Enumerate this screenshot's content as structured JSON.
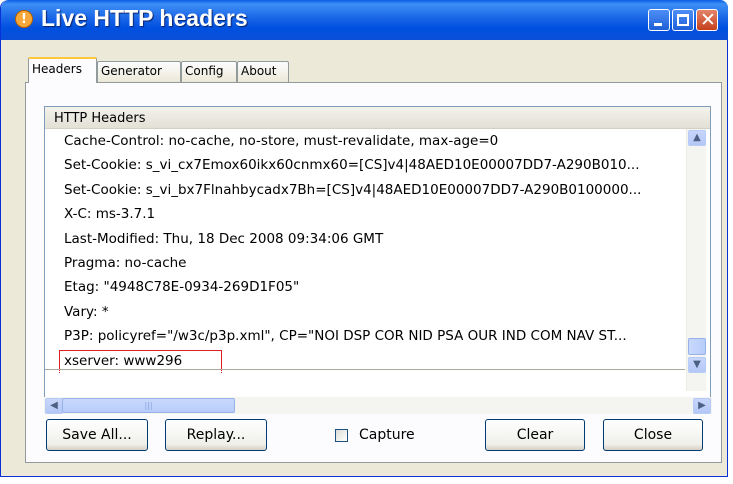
{
  "window": {
    "title": "Live HTTP headers",
    "app_icon": "livehttpheaders-icon",
    "controls": {
      "minimize": "minimize-icon",
      "maximize": "maximize-icon",
      "close": "close-icon"
    }
  },
  "tabs": [
    {
      "label": "Headers",
      "active": true
    },
    {
      "label": "Generator",
      "active": false
    },
    {
      "label": "Config",
      "active": false
    },
    {
      "label": "About",
      "active": false
    }
  ],
  "headers_panel": {
    "column_header": "HTTP Headers",
    "rows": [
      "Cache-Control: no-cache, no-store, must-revalidate, max-age=0",
      "Set-Cookie: s_vi_cx7Emox60ikx60cnmx60=[CS]v4|48AED10E00007DD7-A290B010...",
      "Set-Cookie: s_vi_bx7Flnahbycadx7Bh=[CS]v4|48AED10E00007DD7-A290B0100000...",
      "X-C: ms-3.7.1",
      "Last-Modified: Thu, 18 Dec 2008 09:34:06 GMT",
      "Pragma: no-cache",
      "Etag: \"4948C78E-0934-269D1F05\"",
      "Vary: *",
      "P3P: policyref=\"/w3c/p3p.xml\", CP=\"NOI DSP COR NID PSA OUR IND COM NAV ST...",
      "xserver: www296"
    ],
    "highlight_color": "#e02020"
  },
  "buttons": {
    "save_all": "Save All...",
    "replay": "Replay...",
    "clear": "Clear",
    "close": "Close"
  },
  "capture": {
    "label": "Capture",
    "checked": false
  },
  "colors": {
    "title_bar": "#0054e3",
    "window_face": "#ece9d8",
    "active_tab_accent": "#ffc73c"
  }
}
